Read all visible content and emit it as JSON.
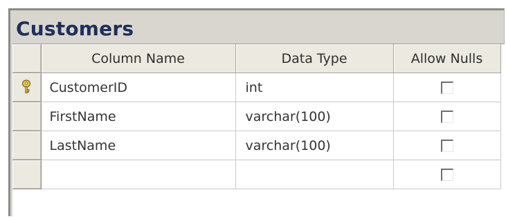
{
  "table_designer": {
    "title": "Customers",
    "columns_header": {
      "column_name": "Column Name",
      "data_type": "Data Type",
      "allow_nulls": "Allow Nulls"
    },
    "rows": [
      {
        "column_name": "CustomerID",
        "data_type": "int",
        "allow_nulls": false,
        "primary_key": true
      },
      {
        "column_name": "FirstName",
        "data_type": "varchar(100)",
        "allow_nulls": false,
        "primary_key": false
      },
      {
        "column_name": "LastName",
        "data_type": "varchar(100)",
        "allow_nulls": false,
        "primary_key": false
      },
      {
        "column_name": "",
        "data_type": "",
        "allow_nulls": false,
        "primary_key": false
      }
    ],
    "icons": {
      "primary_key": "key-icon",
      "checkbox": "checkbox-unchecked"
    }
  }
}
